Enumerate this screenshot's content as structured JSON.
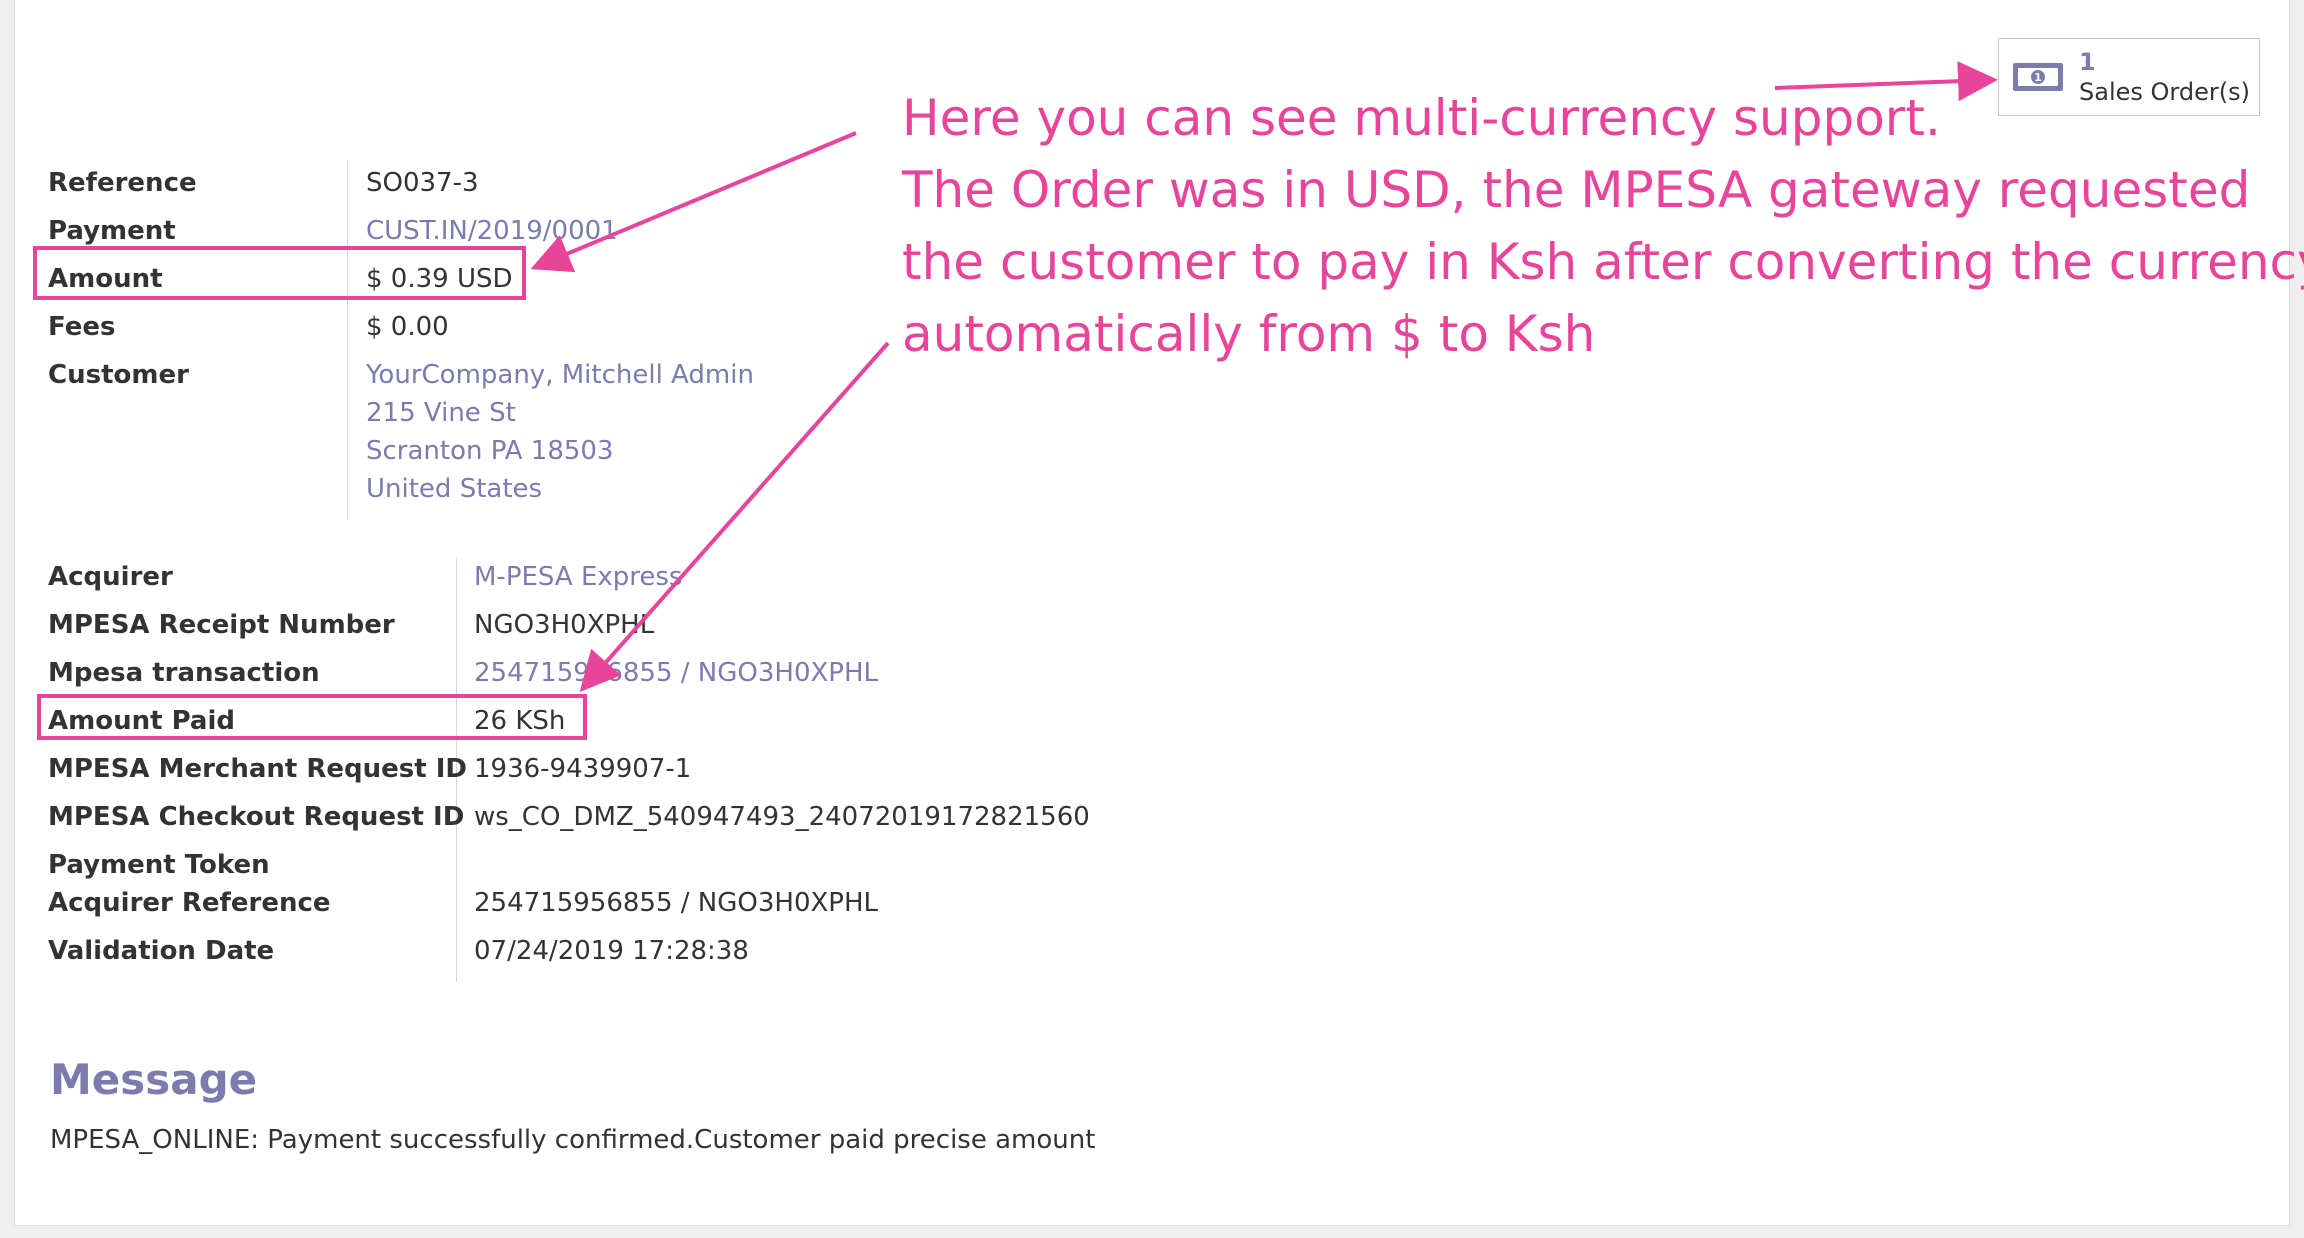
{
  "smart_button": {
    "count": "1",
    "label": "Sales Order(s)",
    "icon": "money-icon"
  },
  "transaction": {
    "reference_label": "Reference",
    "reference_value": "SO037-3",
    "payment_label": "Payment",
    "payment_value": "CUST.IN/2019/0001",
    "amount_label": "Amount",
    "amount_value": "$ 0.39 USD",
    "fees_label": "Fees",
    "fees_value": "$ 0.00",
    "customer_label": "Customer",
    "customer_lines": [
      "YourCompany, Mitchell Admin",
      "215 Vine St",
      "Scranton PA 18503",
      "United States"
    ]
  },
  "acquirer": {
    "acquirer_label": "Acquirer",
    "acquirer_value": "M-PESA Express",
    "receipt_label": "MPESA Receipt Number",
    "receipt_value": "NGO3H0XPHL",
    "transaction_label": "Mpesa transaction",
    "transaction_value": "254715956855 / NGO3H0XPHL",
    "amount_paid_label": "Amount Paid",
    "amount_paid_value": "26 KSh",
    "merchant_label": "MPESA Merchant Request ID",
    "merchant_value": "1936-9439907-1",
    "checkout_label": "MPESA Checkout Request ID",
    "checkout_value": "ws_CO_DMZ_540947493_24072019172821560",
    "token_label": "Payment Token",
    "acq_ref_label": "Acquirer Reference",
    "acq_ref_value": "254715956855 / NGO3H0XPHL",
    "validation_label": "Validation Date",
    "validation_value": "07/24/2019 17:28:38"
  },
  "message": {
    "title": "Message",
    "text": "MPESA_ONLINE: Payment successfully confirmed.Customer paid precise amount"
  },
  "annotation": {
    "lines": [
      "Here you can see multi-currency support.",
      "The Order was in USD, the MPESA gateway requested",
      "the customer to pay in Ksh after converting the currency",
      "automatically from $ to Ksh"
    ],
    "color": "#e8449a"
  },
  "colors": {
    "link": "#7c7bad",
    "annotation": "#e8449a"
  }
}
